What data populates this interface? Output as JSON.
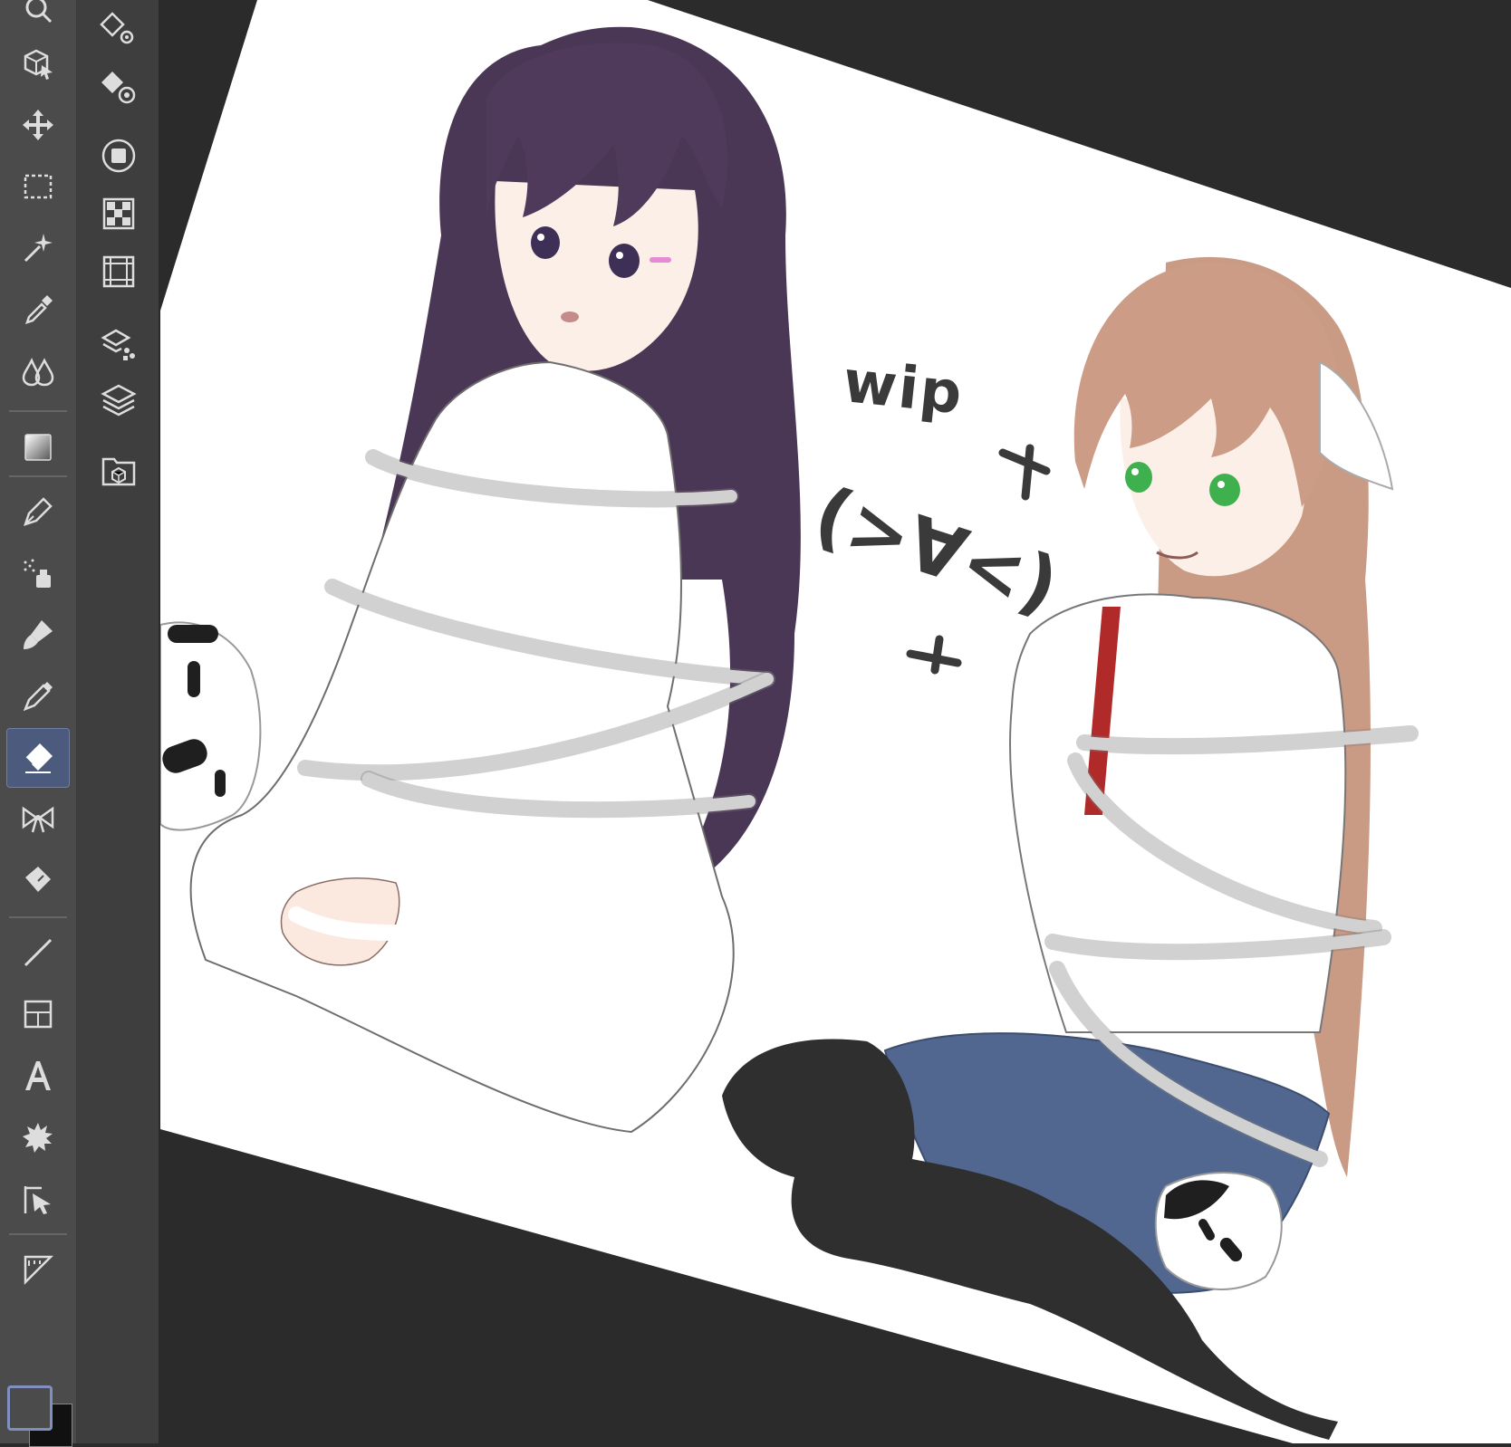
{
  "app": {
    "tools": [
      {
        "name": "zoom-tool",
        "active": false
      },
      {
        "name": "operation-tool",
        "active": false
      },
      {
        "name": "move-layer-tool",
        "active": false
      },
      {
        "name": "selection-tool",
        "active": false
      },
      {
        "name": "auto-select-tool",
        "active": false
      },
      {
        "name": "eyedropper-tool",
        "active": false
      },
      {
        "name": "blend-tool",
        "active": false
      },
      {
        "name": "gradient-tool",
        "active": false
      },
      {
        "name": "pen-tool",
        "active": false
      },
      {
        "name": "airbrush-tool",
        "active": false
      },
      {
        "name": "brush-tool",
        "active": false
      },
      {
        "name": "decoration-tool",
        "active": false
      },
      {
        "name": "eraser-tool",
        "active": true
      },
      {
        "name": "blend-ribbon-tool",
        "active": false
      },
      {
        "name": "fill-tool",
        "active": false
      },
      {
        "name": "line-tool",
        "active": false
      },
      {
        "name": "frame-tool",
        "active": false
      },
      {
        "name": "text-tool",
        "active": false
      },
      {
        "name": "balloon-tool",
        "active": false
      },
      {
        "name": "correct-line-tool",
        "active": false
      },
      {
        "name": "ruler-tool",
        "active": false
      }
    ],
    "subtools": [
      "eraser-settings-icon",
      "fill-target-icon",
      "navigator-icon",
      "color-set-icon",
      "animation-timeline-icon",
      "layer-property-icon",
      "layers-icon",
      "material-icon"
    ],
    "colors": {
      "foreground": "#111111",
      "background": "#4b4b4b",
      "active_tool_bg": "#4c5a7e",
      "toolbar_bg": "#4b4b4b",
      "canvas_backdrop": "#2b2b2b"
    }
  },
  "canvas": {
    "wip_text": "wip",
    "kaomoji_text": "(>∀<)",
    "colors": {
      "purple_hair": "#4a3655",
      "brown_hair": "#c99a84",
      "skirt": "#51678f",
      "stockings": "#2f2f2f",
      "shirt": "#ffffff",
      "rope": "#ffffff"
    }
  }
}
